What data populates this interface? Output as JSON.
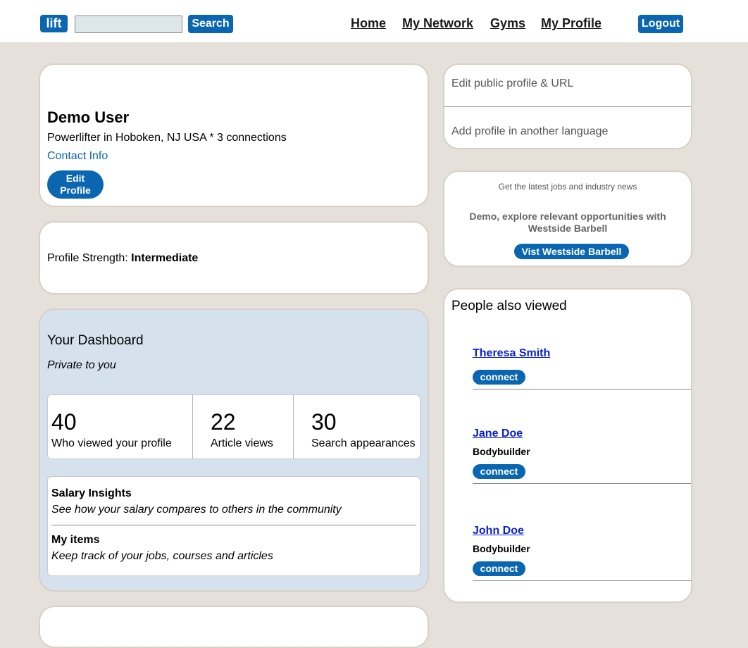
{
  "header": {
    "logo": "lift",
    "search_placeholder": "",
    "search_button": "Search",
    "nav": [
      "Home",
      "My Network",
      "Gyms",
      "My Profile"
    ],
    "logout": "Logout"
  },
  "profile": {
    "name": "Demo User",
    "headline": "Powerlifter in Hoboken, NJ USA * 3 connections",
    "contact_info": "Contact Info",
    "edit_button_line1": "Edit",
    "edit_button_line2": "Profile"
  },
  "strength": {
    "label": "Profile Strength: ",
    "value": "Intermediate"
  },
  "dashboard": {
    "title": "Your Dashboard",
    "subtitle": "Private to you",
    "stats": [
      {
        "value": "40",
        "label": "Who viewed your profile"
      },
      {
        "value": "22",
        "label": "Article views"
      },
      {
        "value": "30",
        "label": "Search appearances"
      }
    ],
    "insights": [
      {
        "title": "Salary Insights",
        "desc": "See how your salary compares to others in the community"
      },
      {
        "title": "My items",
        "desc": "Keep track of your jobs, courses and articles"
      }
    ]
  },
  "sidebar": {
    "links": [
      "Edit public profile & URL",
      "Add profile in another language"
    ]
  },
  "promo": {
    "tagline": "Get the latest jobs and industry news",
    "message_line1": "Demo, explore relevant opportunities with",
    "message_line2": "Westside Barbell",
    "button": "Vist Westside Barbell"
  },
  "people": {
    "title": "People also viewed",
    "connect_label": "connect",
    "list": [
      {
        "name": "Theresa Smith",
        "title": ""
      },
      {
        "name": "Jane Doe",
        "title": "Bodybuilder"
      },
      {
        "name": "John Doe",
        "title": "Bodybuilder"
      }
    ]
  },
  "colors": {
    "accent": "#0a66b0",
    "page_background": "#e5e0da",
    "dashboard_background": "#d5e1ec"
  }
}
